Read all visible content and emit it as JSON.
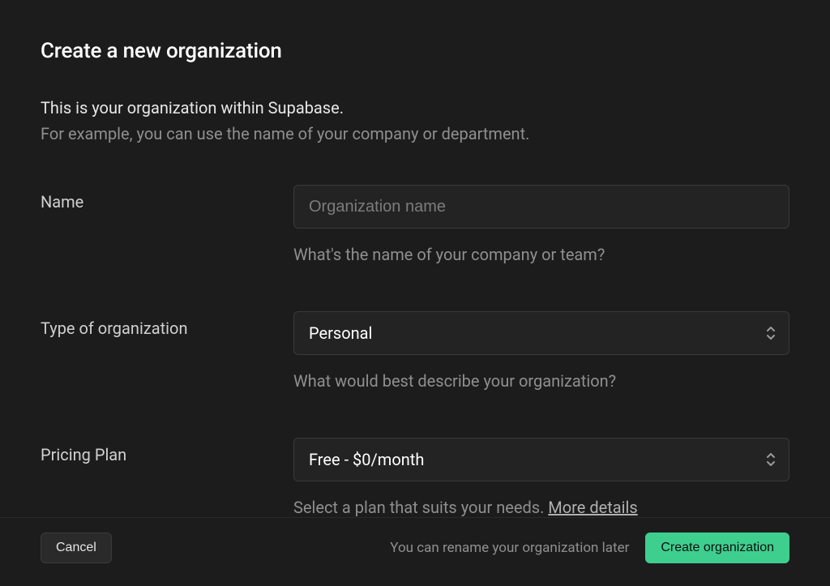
{
  "dialog": {
    "title": "Create a new organization"
  },
  "intro": {
    "text": "This is your organization within Supabase.",
    "sub": "For example, you can use the name of your company or department."
  },
  "form": {
    "name": {
      "label": "Name",
      "placeholder": "Organization name",
      "value": "",
      "hint": "What's the name of your company or team?"
    },
    "type": {
      "label": "Type of organization",
      "value": "Personal",
      "hint": "What would best describe your organization?"
    },
    "plan": {
      "label": "Pricing Plan",
      "value": "Free - $0/month",
      "hint_prefix": "Select a plan that suits your needs. ",
      "more_link": "More details"
    }
  },
  "footer": {
    "cancel": "Cancel",
    "note": "You can rename your organization later",
    "submit": "Create organization"
  },
  "colors": {
    "accent": "#3ecf8e",
    "bg": "#1c1c1c",
    "surface": "#232323",
    "border": "#3a3a3a",
    "muted": "#8f8f8f"
  }
}
